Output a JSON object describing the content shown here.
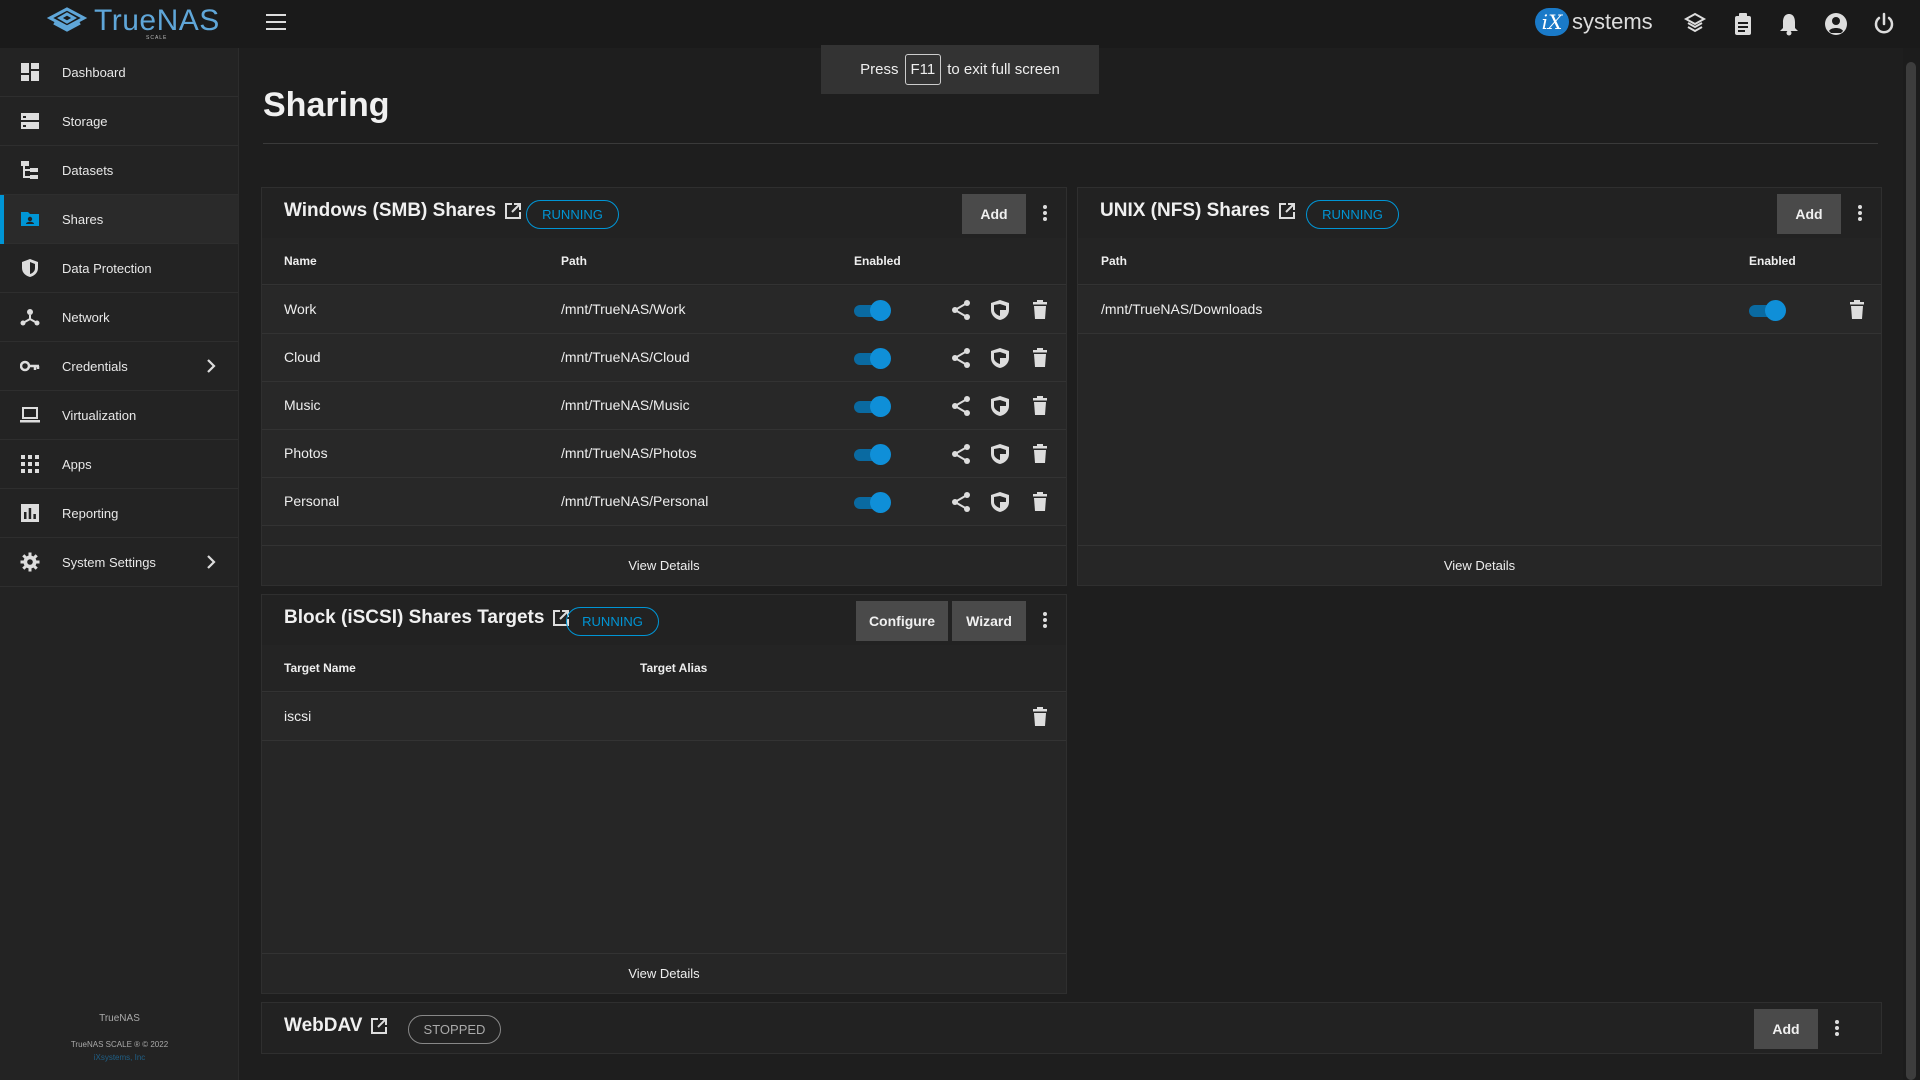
{
  "app": {
    "logo_text": "TrueNAS",
    "logo_sub": "SCALE",
    "brand_ix": "iX",
    "brand_word": "systems"
  },
  "fullscreen_toast": {
    "before": "Press",
    "key": "F11",
    "after": "to exit full screen"
  },
  "sidebar": {
    "items": [
      {
        "label": "Dashboard",
        "icon": "dashboard-icon"
      },
      {
        "label": "Storage",
        "icon": "storage-icon"
      },
      {
        "label": "Datasets",
        "icon": "datasets-icon"
      },
      {
        "label": "Shares",
        "icon": "shares-icon",
        "active": true
      },
      {
        "label": "Data Protection",
        "icon": "shield-icon"
      },
      {
        "label": "Network",
        "icon": "network-icon"
      },
      {
        "label": "Credentials",
        "icon": "key-icon",
        "expandable": true
      },
      {
        "label": "Virtualization",
        "icon": "laptop-icon"
      },
      {
        "label": "Apps",
        "icon": "apps-grid-icon"
      },
      {
        "label": "Reporting",
        "icon": "chart-icon"
      },
      {
        "label": "System Settings",
        "icon": "gear-icon",
        "expandable": true
      }
    ],
    "footer": {
      "name": "TrueNAS",
      "copyright": "TrueNAS SCALE ® © 2022",
      "company": "iXsystems, Inc"
    }
  },
  "page": {
    "title": "Sharing"
  },
  "smb": {
    "title": "Windows (SMB) Shares",
    "status": "RUNNING",
    "add_label": "Add",
    "columns": [
      "Name",
      "Path",
      "Enabled"
    ],
    "rows": [
      {
        "name": "Work",
        "path": "/mnt/TrueNAS/Work",
        "enabled": true
      },
      {
        "name": "Cloud",
        "path": "/mnt/TrueNAS/Cloud",
        "enabled": true
      },
      {
        "name": "Music",
        "path": "/mnt/TrueNAS/Music",
        "enabled": true
      },
      {
        "name": "Photos",
        "path": "/mnt/TrueNAS/Photos",
        "enabled": true
      },
      {
        "name": "Personal",
        "path": "/mnt/TrueNAS/Personal",
        "enabled": true
      }
    ],
    "view_details": "View Details"
  },
  "nfs": {
    "title": "UNIX (NFS) Shares",
    "status": "RUNNING",
    "add_label": "Add",
    "columns": [
      "Path",
      "Enabled"
    ],
    "rows": [
      {
        "path": "/mnt/TrueNAS/Downloads",
        "enabled": true
      }
    ],
    "view_details": "View Details"
  },
  "iscsi": {
    "title": "Block (iSCSI) Shares Targets",
    "status": "RUNNING",
    "configure_label": "Configure",
    "wizard_label": "Wizard",
    "columns": [
      "Target Name",
      "Target Alias"
    ],
    "rows": [
      {
        "name": "iscsi",
        "alias": ""
      }
    ],
    "view_details": "View Details"
  },
  "webdav": {
    "title": "WebDAV",
    "status": "STOPPED",
    "add_label": "Add"
  },
  "colors": {
    "accent": "#0095d5",
    "toggle_on": "#0f8fd8",
    "background": "#1e1e1e"
  }
}
